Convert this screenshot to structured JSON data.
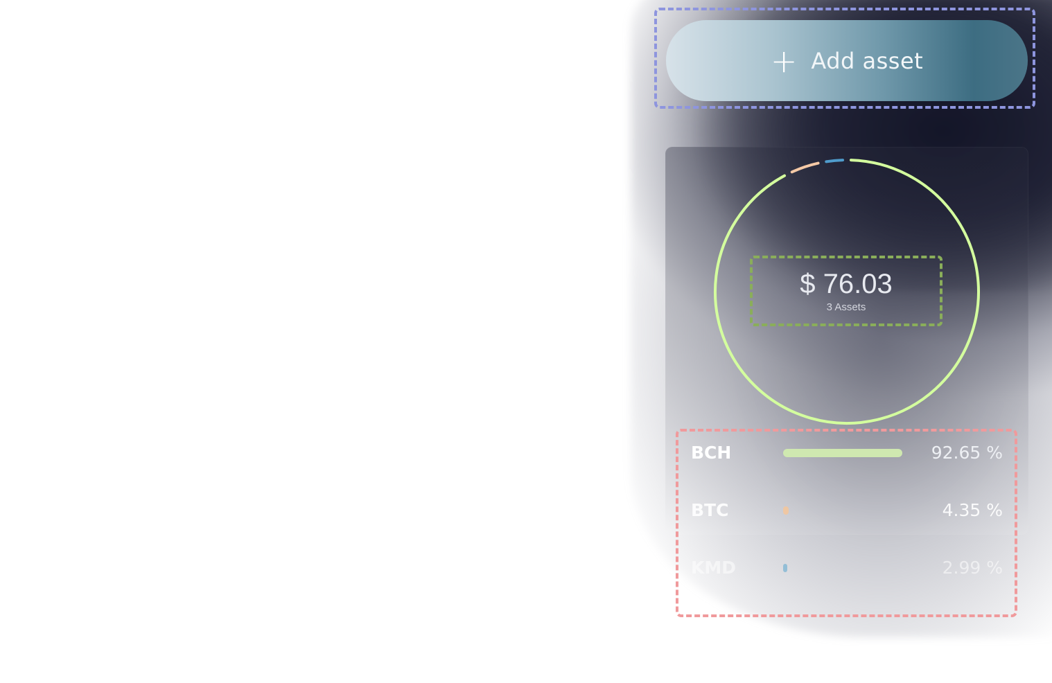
{
  "add_asset": {
    "icon": "plus-icon",
    "plus_glyph": "+",
    "label": "Add asset"
  },
  "portfolio": {
    "total": "$ 76.03",
    "asset_count": "3 Assets"
  },
  "assets": [
    {
      "symbol": "BCH",
      "percent": "92.65 %",
      "share": 0.9265,
      "color": "#cfe8b0",
      "ring_color": "#d4ff9e"
    },
    {
      "symbol": "BTC",
      "percent": "4.35 %",
      "share": 0.0435,
      "color": "#f2c7a0",
      "ring_color": "#f5c9a6"
    },
    {
      "symbol": "KMD",
      "percent": "2.99 %",
      "share": 0.0299,
      "color": "#5aa7cf",
      "ring_color": "#4f9ccc"
    }
  ]
}
